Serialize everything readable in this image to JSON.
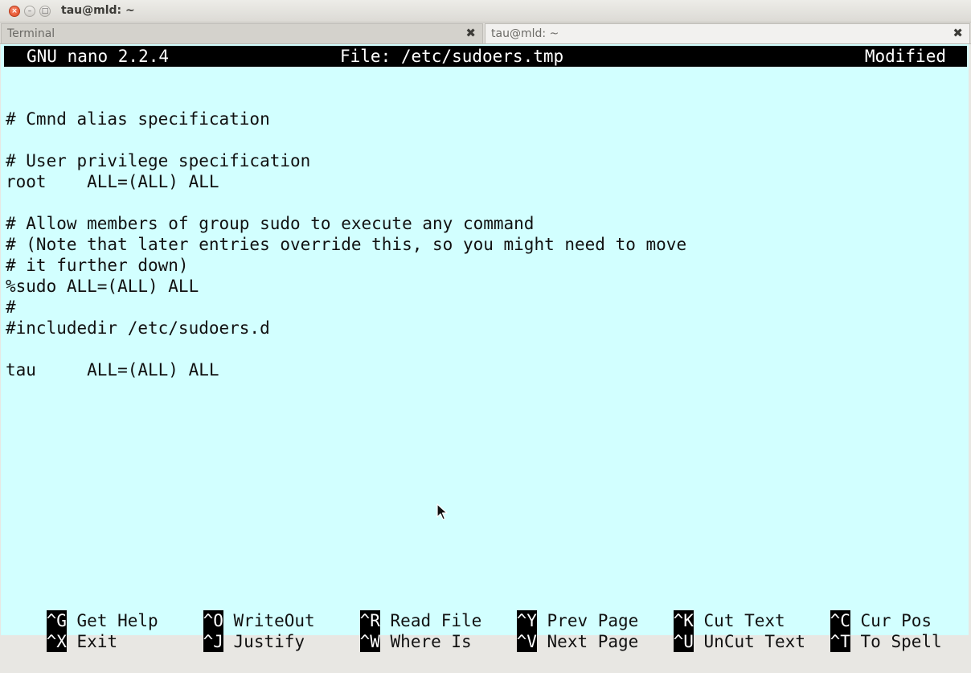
{
  "window": {
    "title": "tau@mld: ~",
    "controls": {
      "close": "×",
      "minimize": "–",
      "maximize": "□"
    }
  },
  "tabs": [
    {
      "label": "Terminal",
      "close": "✖"
    },
    {
      "label": "tau@mld: ~",
      "close": "✖"
    }
  ],
  "colors": {
    "terminal_bg": "#d2ffff",
    "header_bg": "#000000"
  },
  "nano": {
    "version": "GNU nano 2.2.4",
    "file": "File: /etc/sudoers.tmp",
    "status": "Modified"
  },
  "lines": [
    "",
    "",
    "# Cmnd alias specification",
    "",
    "# User privilege specification",
    "root    ALL=(ALL) ALL",
    "",
    "# Allow members of group sudo to execute any command",
    "# (Note that later entries override this, so you might need to move",
    "# it further down)",
    "%sudo ALL=(ALL) ALL",
    "#",
    "#includedir /etc/sudoers.d",
    "",
    "tau     ALL=(ALL) ALL"
  ],
  "shortcuts": [
    {
      "key": "^G",
      "label": "Get Help"
    },
    {
      "key": "^O",
      "label": "WriteOut"
    },
    {
      "key": "^R",
      "label": "Read File"
    },
    {
      "key": "^Y",
      "label": "Prev Page"
    },
    {
      "key": "^K",
      "label": "Cut Text"
    },
    {
      "key": "^C",
      "label": "Cur Pos"
    },
    {
      "key": "^X",
      "label": "Exit"
    },
    {
      "key": "^J",
      "label": "Justify"
    },
    {
      "key": "^W",
      "label": "Where Is"
    },
    {
      "key": "^V",
      "label": "Next Page"
    },
    {
      "key": "^U",
      "label": "UnCut Text"
    },
    {
      "key": "^T",
      "label": "To Spell"
    }
  ]
}
